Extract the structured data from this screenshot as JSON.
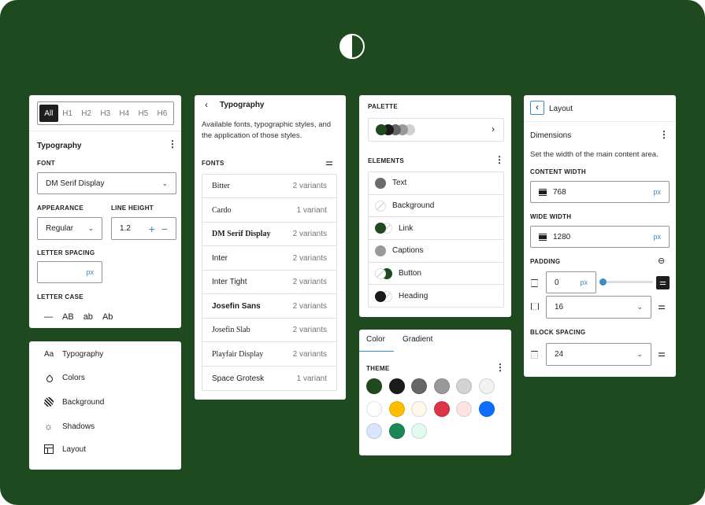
{
  "colors": {
    "background": "#1f4a1f",
    "accent": "#3a8bc9",
    "dark": "#1e1e1e"
  },
  "logo_icon": "half-circle-contrast-icon",
  "heading_panel": {
    "tabs": [
      "All",
      "H1",
      "H2",
      "H3",
      "H4",
      "H5",
      "H6"
    ],
    "active_tab": "All",
    "title": "Typography",
    "font_label": "FONT",
    "font_value": "DM Serif Display",
    "appearance_label": "APPEARANCE",
    "appearance_value": "Regular",
    "line_height_label": "LINE HEIGHT",
    "line_height_value": "1.2",
    "letter_spacing_label": "LETTER SPACING",
    "letter_spacing_unit": "px",
    "letter_case_label": "LETTER CASE",
    "letter_case_options": [
      "—",
      "AB",
      "ab",
      "Ab"
    ]
  },
  "nav_panel": {
    "items": [
      {
        "icon": "typography-icon",
        "glyph": "Aa",
        "label": "Typography"
      },
      {
        "icon": "droplet-icon",
        "glyph": "",
        "label": "Colors"
      },
      {
        "icon": "background-icon",
        "glyph": "",
        "label": "Background"
      },
      {
        "icon": "shadow-icon",
        "glyph": "☼",
        "label": "Shadows"
      },
      {
        "icon": "layout-icon",
        "glyph": "",
        "label": "Layout"
      }
    ]
  },
  "fonts_panel": {
    "title": "Typography",
    "description": "Available fonts, typographic styles, and the application of those styles.",
    "fonts_label": "FONTS",
    "fonts": [
      {
        "name": "Bitter",
        "variants": "2 variants"
      },
      {
        "name": "Cardo",
        "variants": "1 variant"
      },
      {
        "name": "DM Serif Display",
        "variants": "2 variants"
      },
      {
        "name": "Inter",
        "variants": "2 variants"
      },
      {
        "name": "Inter Tight",
        "variants": "2 variants"
      },
      {
        "name": "Josefin Sans",
        "variants": "2 variants"
      },
      {
        "name": "Josefin Slab",
        "variants": "2 variants"
      },
      {
        "name": "Playfair Display",
        "variants": "2 variants"
      },
      {
        "name": "Space Grotesk",
        "variants": "1 variant"
      }
    ]
  },
  "elements_panel": {
    "palette_label": "PALETTE",
    "palette_preview": [
      "#1f4a1f",
      "#1a1a1a",
      "#666666",
      "#999999",
      "#d0d0d0"
    ],
    "elements_label": "ELEMENTS",
    "elements": [
      {
        "label": "Text",
        "colors": [
          "#6a6a6a"
        ]
      },
      {
        "label": "Background",
        "colors": [
          "none"
        ]
      },
      {
        "label": "Link",
        "colors": [
          "#1f4a1f",
          "none"
        ]
      },
      {
        "label": "Captions",
        "colors": [
          "#9a9a9a"
        ]
      },
      {
        "label": "Button",
        "colors": [
          "none",
          "#1f4a1f"
        ]
      },
      {
        "label": "Heading",
        "colors": [
          "#1a1a1a",
          "none"
        ]
      }
    ]
  },
  "color_panel": {
    "tabs": [
      "Color",
      "Gradient"
    ],
    "active_tab": "Color",
    "theme_label": "THEME",
    "swatches": [
      "#1f4a1f",
      "#1a1a1a",
      "#666666",
      "#999999",
      "#d3d3d3",
      "#f2f2f2",
      "#ffffff",
      "#fcbf00",
      "#fdf8ea",
      "#dc3545",
      "#fde2e4",
      "#0d6efd",
      "#d8e6fc",
      "#1a8754",
      "#e0fbee"
    ]
  },
  "layout_panel": {
    "title": "Layout",
    "section": "Dimensions",
    "description": "Set the width of the main content area.",
    "content_width_label": "CONTENT WIDTH",
    "content_width": "768",
    "unit": "px",
    "wide_width_label": "WIDE WIDTH",
    "wide_width": "1280",
    "padding_label": "PADDING",
    "padding_vertical": "0",
    "padding_slider": 0,
    "padding_horizontal": "16",
    "block_spacing_label": "BLOCK SPACING",
    "block_spacing": "24"
  }
}
